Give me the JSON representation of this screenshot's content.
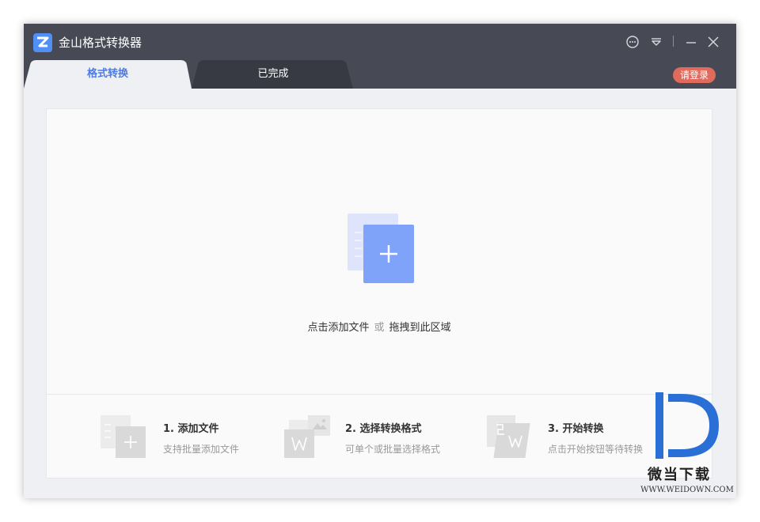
{
  "app": {
    "title": "金山格式转换器"
  },
  "title_controls": [
    "chat-icon",
    "menu-icon",
    "minimize-icon",
    "close-icon"
  ],
  "tabs": [
    {
      "label": "格式转换",
      "active": true
    },
    {
      "label": "已完成",
      "active": false
    }
  ],
  "login": {
    "label": "请登录"
  },
  "drop_zone": {
    "icon": "add-file-icon",
    "prefix": "点击添加文件",
    "or": "或",
    "suffix": "拖拽到此区域"
  },
  "steps": [
    {
      "title": "1. 添加文件",
      "desc": "支持批量添加文件",
      "icon": "add-file-step-icon"
    },
    {
      "title": "2. 选择转换格式",
      "desc": "可单个或批量选择格式",
      "icon": "select-format-icon"
    },
    {
      "title": "3. 开始转换",
      "desc": "点击开始按钮等待转换",
      "icon": "start-convert-icon"
    }
  ],
  "watermark": {
    "name": "微当下载",
    "url": "WWW.WEIDOWN.COM"
  },
  "colors": {
    "titlebar": "#474a54",
    "accent": "#4a7bea",
    "login": "#e06a5c",
    "icon_blue": "#7fa3f8"
  }
}
